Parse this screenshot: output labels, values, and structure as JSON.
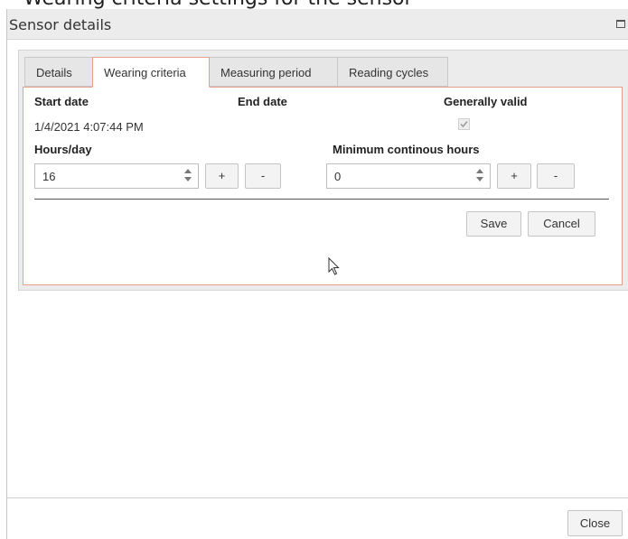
{
  "background_text": "Wearing criteria settings for the sensor",
  "dialog": {
    "title": "Sensor details",
    "close_label": "Close"
  },
  "tabs": [
    {
      "label": "Details",
      "active": false
    },
    {
      "label": "Wearing criteria",
      "active": true
    },
    {
      "label": "Measuring period",
      "active": false
    },
    {
      "label": "Reading cycles",
      "active": false
    }
  ],
  "form": {
    "start_date_label": "Start date",
    "end_date_label": "End date",
    "generally_valid_label": "Generally valid",
    "start_date_value": "1/4/2021 4:07:44 PM",
    "end_date_value": "",
    "generally_valid_checked": true,
    "hours_per_day_label": "Hours/day",
    "hours_per_day_value": "16",
    "min_continuous_label": "Minimum continous hours",
    "min_continuous_value": "0",
    "plus_label": "+",
    "minus_label": "-",
    "save_label": "Save",
    "cancel_label": "Cancel"
  },
  "colors": {
    "accent_border": "#e8a08a",
    "titlebar_bg": "#ececec"
  }
}
